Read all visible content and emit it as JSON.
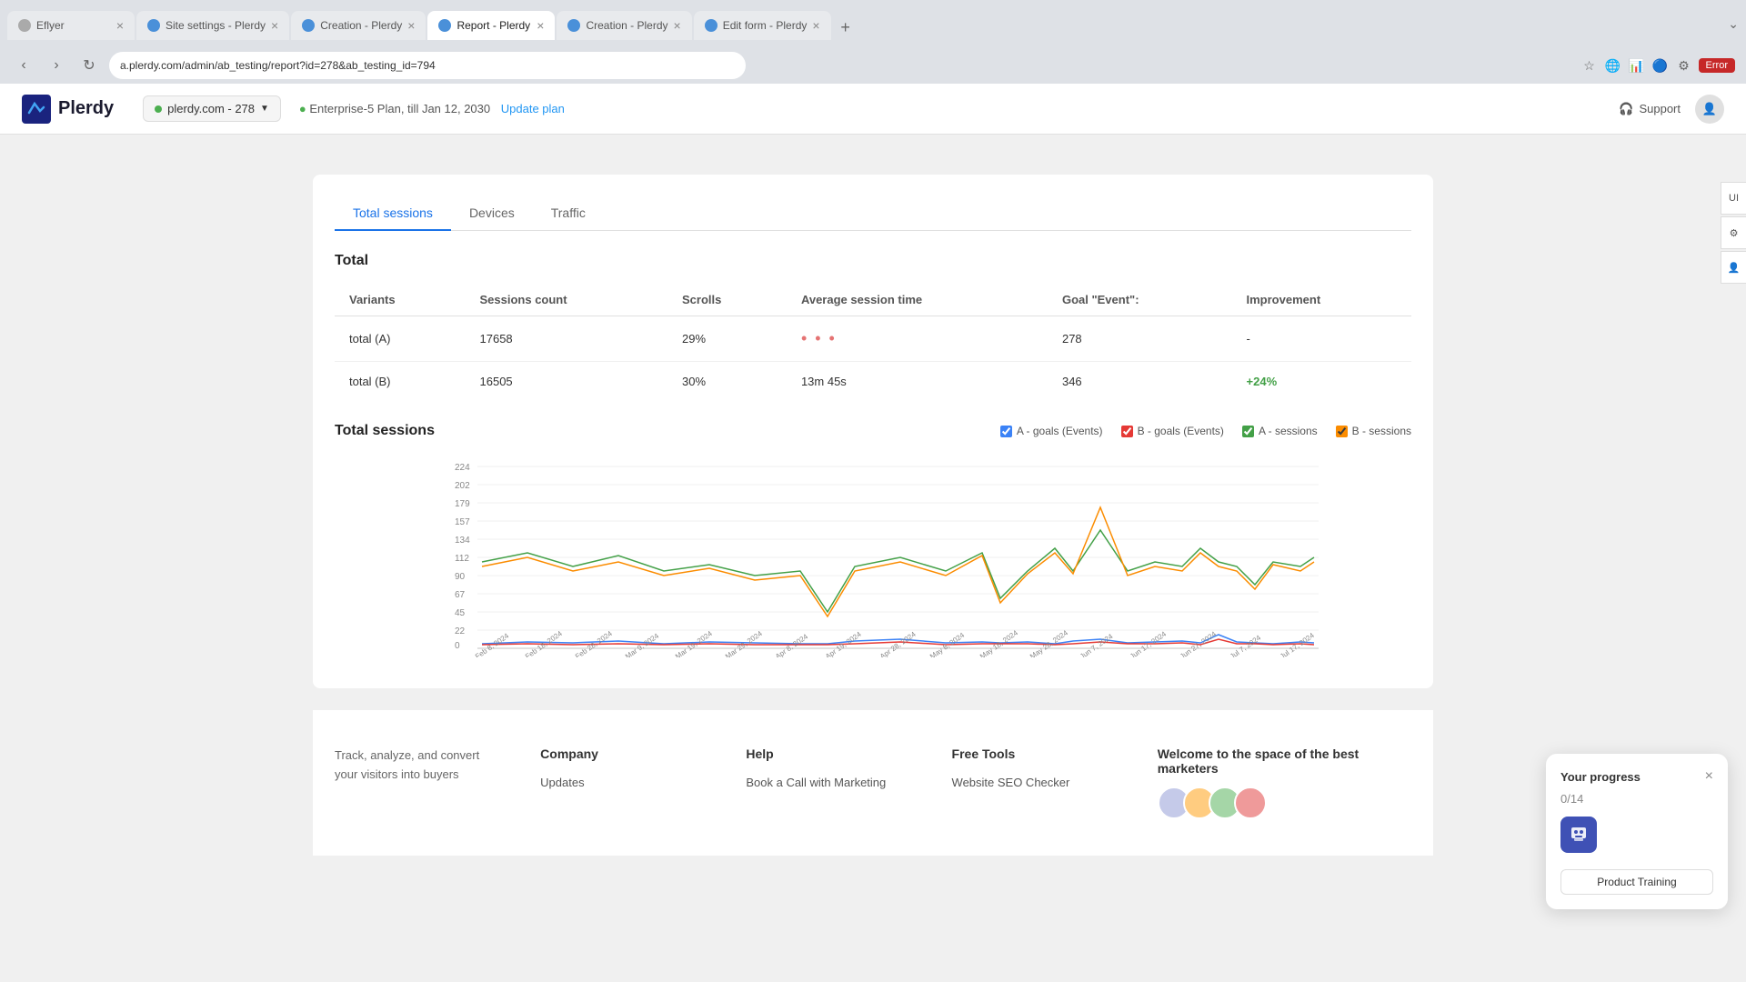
{
  "browser": {
    "tabs": [
      {
        "id": "tab1",
        "icon": "page-icon",
        "label": "Eflyer",
        "active": false,
        "closable": true
      },
      {
        "id": "tab2",
        "icon": "blue-icon",
        "label": "Site settings - Plerdy",
        "active": false,
        "closable": true
      },
      {
        "id": "tab3",
        "icon": "blue-icon",
        "label": "Creation - Plerdy",
        "active": false,
        "closable": true
      },
      {
        "id": "tab4",
        "icon": "blue-icon",
        "label": "Report - Plerdy",
        "active": true,
        "closable": true
      },
      {
        "id": "tab5",
        "icon": "blue-icon",
        "label": "Creation - Plerdy",
        "active": false,
        "closable": true
      },
      {
        "id": "tab6",
        "icon": "blue-icon",
        "label": "Edit form - Plerdy",
        "active": false,
        "closable": true
      }
    ],
    "address": "a.plerdy.com/admin/ab_testing/report?id=278&ab_testing_id=794",
    "error_label": "Error"
  },
  "header": {
    "logo_text": "Plerdy",
    "site_selector": "plerdy.com - 278",
    "plan_text": "Enterprise-5 Plan, till Jan 12, 2030",
    "update_link": "Update plan",
    "support_label": "Support",
    "user_icon": "👤"
  },
  "page_tabs": [
    {
      "label": "Total sessions",
      "active": true
    },
    {
      "label": "Devices",
      "active": false
    },
    {
      "label": "Traffic",
      "active": false
    }
  ],
  "table": {
    "section_title": "Total",
    "headers": [
      "Variants",
      "Sessions count",
      "Scrolls",
      "Average session time",
      "Goal \"Event\":",
      "Improvement"
    ],
    "rows": [
      {
        "variant": "total (A)",
        "sessions_count": "17658",
        "scrolls": "29%",
        "avg_session": "dots",
        "goal": "278",
        "improvement": "-"
      },
      {
        "variant": "total (B)",
        "sessions_count": "16505",
        "scrolls": "30%",
        "avg_session": "13m 45s",
        "goal": "346",
        "improvement": "+24%"
      }
    ]
  },
  "chart": {
    "title": "Total sessions",
    "legend": [
      {
        "label": "A - goals (Events)",
        "color": "#3b82f6"
      },
      {
        "label": "B - goals (Events)",
        "color": "#e53935"
      },
      {
        "label": "A - sessions",
        "color": "#43a047"
      },
      {
        "label": "B - sessions",
        "color": "#fb8c00"
      }
    ],
    "x_labels": [
      "Feb 8, 2024",
      "Feb 18, 2024",
      "Feb 28, 2024",
      "Mar 9, 2024",
      "Mar 19, 2024",
      "Mar 29, 2024",
      "Apr 8, 2024",
      "Apr 19, 2024",
      "Apr 28, 2024",
      "May 8, 2024",
      "May 18, 2024",
      "May 28, 2024",
      "Jun 7, 2024",
      "Jun 17, 2024",
      "Jun 27, 2024",
      "Jul 7, 2024",
      "Jul 17, 2024"
    ],
    "y_labels": [
      "224",
      "202",
      "179",
      "157",
      "134",
      "112",
      "90",
      "67",
      "45",
      "22",
      "0"
    ]
  },
  "footer": {
    "tagline": "Track, analyze, and convert your visitors into buyers",
    "company": {
      "title": "Company",
      "links": [
        "Updates"
      ]
    },
    "help": {
      "title": "Help",
      "links": [
        "Book a Call with Marketing"
      ]
    },
    "free_tools": {
      "title": "Free Tools",
      "links": [
        "Website SEO Checker"
      ]
    },
    "community": {
      "title": "Welcome to the space of the best marketers"
    }
  },
  "progress_widget": {
    "title": "Your progress",
    "count": "0/14",
    "btn_label": "Product Training",
    "close_label": "×"
  },
  "right_sidebar": {
    "tabs": [
      "UI",
      "⚙",
      "👤"
    ]
  }
}
